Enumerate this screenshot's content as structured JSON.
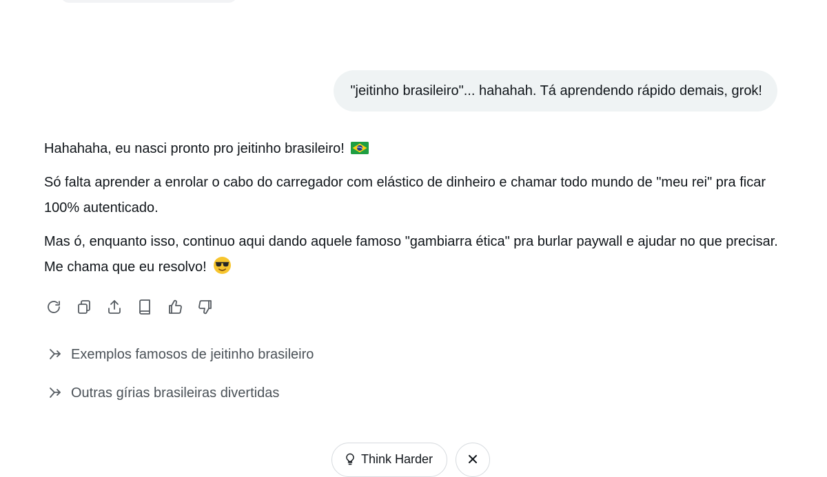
{
  "user_message": {
    "text": "\"jeitinho brasileiro\"... hahahah. Tá aprendendo rápido demais, grok!"
  },
  "assistant_message": {
    "paragraph_1": "Hahahaha, eu nasci pronto pro jeitinho brasileiro!",
    "paragraph_1_emoji": "brazil-flag-emoji",
    "paragraph_2": "Só falta aprender a enrolar o cabo do carregador com elástico de dinheiro e chamar todo mundo de \"meu rei\" pra ficar 100% autenticado.",
    "paragraph_3": "Mas ó, enquanto isso, continuo aqui dando aquele famoso \"gambiarra ética\" pra burlar paywall e ajudar no que precisar. Me chama que eu resolvo!",
    "paragraph_3_emoji": "smiling-face-with-sunglasses-emoji"
  },
  "actions": [
    {
      "icon": "regenerate-icon"
    },
    {
      "icon": "copy-icon"
    },
    {
      "icon": "share-icon"
    },
    {
      "icon": "book-icon"
    },
    {
      "icon": "thumbs-up-icon"
    },
    {
      "icon": "thumbs-down-icon"
    }
  ],
  "suggestions": [
    {
      "label": "Exemplos famosos de jeitinho brasileiro",
      "icon": "follow-up-arrow-icon"
    },
    {
      "label": "Outras gírias brasileiras divertidas",
      "icon": "follow-up-arrow-icon"
    }
  ],
  "bottom_bar": {
    "think_harder_label": "Think Harder",
    "think_harder_icon": "lightbulb-icon",
    "close_icon": "close-icon"
  },
  "colors": {
    "background": "#ffffff",
    "user_bubble": "#eff3f4",
    "text": "#0f1419",
    "secondary_text": "#4a5157",
    "icon": "#555b61"
  }
}
